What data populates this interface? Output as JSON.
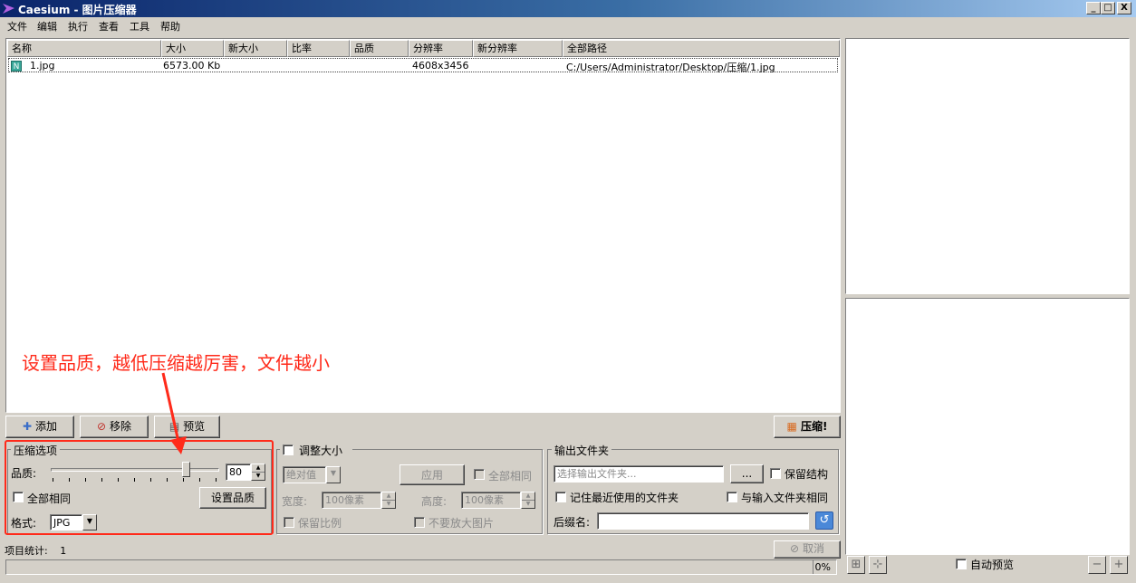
{
  "window": {
    "title": "Caesium - 图片压缩器",
    "min": "_",
    "max": "□",
    "close": "X"
  },
  "menu": [
    "文件",
    "编辑",
    "执行",
    "查看",
    "工具",
    "帮助"
  ],
  "filelist": {
    "columns": [
      "名称",
      "大小",
      "新大小",
      "比率",
      "品质",
      "分辨率",
      "新分辨率",
      "全部路径"
    ],
    "rows": [
      {
        "icon": "N",
        "name": "1.jpg",
        "size": "6573.00 Kb",
        "new_size": "",
        "ratio": "",
        "quality": "",
        "resolution": "4608x3456",
        "new_resolution": "",
        "path": "C:/Users/Administrator/Desktop/压缩/1.jpg"
      }
    ]
  },
  "toolbar": {
    "add": "添加",
    "remove": "移除",
    "preview": "预览",
    "compress": "压缩!"
  },
  "compression": {
    "title": "压缩选项",
    "quality_label": "品质:",
    "quality_value": "80",
    "quality_fraction": 0.8,
    "all_same": "全部相同",
    "set_quality": "设置品质",
    "format_label": "格式:",
    "format_value": "JPG"
  },
  "resize": {
    "title": "调整大小",
    "mode": "绝对值",
    "apply": "应用",
    "all_same": "全部相同",
    "width_label": "宽度:",
    "width_value": "100像素",
    "height_label": "高度:",
    "height_value": "100像素",
    "keep_ratio": "保留比例",
    "no_enlarge": "不要放大图片"
  },
  "output": {
    "title": "输出文件夹",
    "placeholder": "选择输出文件夹...",
    "browse": "...",
    "keep_structure": "保留结构",
    "remember_last": "记住最近使用的文件夹",
    "same_as_input": "与输入文件夹相同",
    "suffix_label": "后缀名:",
    "suffix_value": ""
  },
  "status": {
    "items_label": "项目统计:",
    "items_count": "1",
    "cancel": "取消",
    "progress_text": "0%",
    "progress": 0
  },
  "preview_panel": {
    "auto_preview": "自动预览"
  },
  "annotation": {
    "text": "设置品质，越低压缩越厉害，文件越小"
  },
  "colors": {
    "title_start": "#0a246a",
    "annotation": "#ff2a1a",
    "window_bg": "#d4d0c8"
  }
}
